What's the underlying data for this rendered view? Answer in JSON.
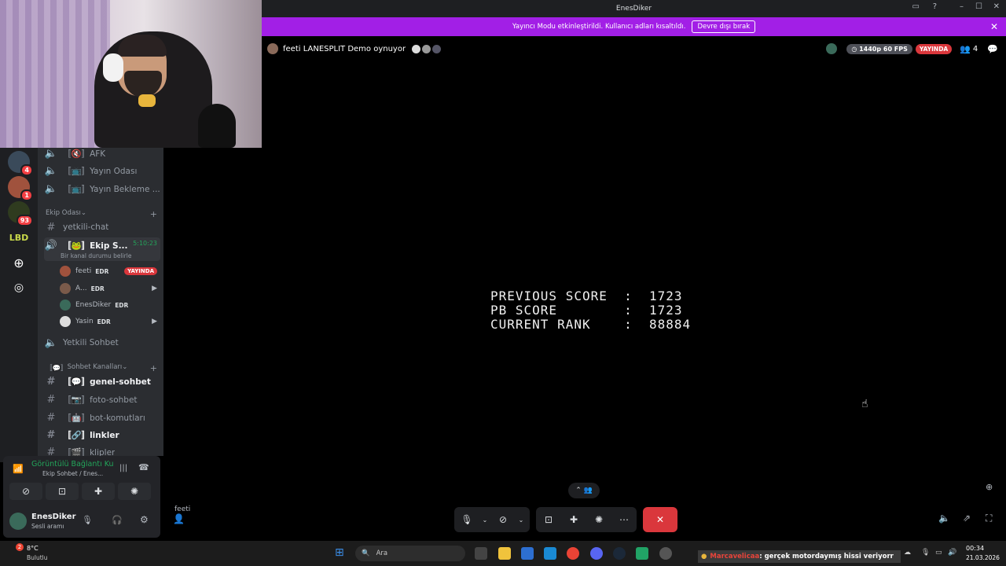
{
  "window": {
    "title": "EnesDiker",
    "minimize": "–",
    "maximize": "☐",
    "close": "✕"
  },
  "banner": {
    "message": "Yayıncı Modu etkinleştirildi. Kullanıcı adları kısaltıldı.",
    "button": "Devre dışı bırak",
    "close": "✕"
  },
  "stream": {
    "title": "feeti LANESPLIT Demo oynuyor",
    "quality": "1440p 60 FPS",
    "live": "YAYINDA",
    "viewers": "4",
    "participant": "feeti"
  },
  "game": {
    "lines": "PREVIOUS SCORE  :  1723\nPB SCORE        :  1723\nCURRENT RANK    :  88884"
  },
  "servers": [
    {
      "badge": "4"
    },
    {
      "badge": "1"
    },
    {
      "badge": "93"
    },
    {
      "label": "LBD"
    }
  ],
  "channels": {
    "afk": "AFK",
    "yayin_odasi": "Yayın Odası",
    "yayin_bekleme": "Yayın Bekleme ...",
    "cat_ekip": "Ekip Odası",
    "yetkili_chat": "yetkili-chat",
    "ekip_voice": "Ekip S...",
    "ekip_timer": "5:10:23",
    "ekip_status": "Bir kanal durumu belirle",
    "yetkili_sohbet": "Yetkili Sohbet",
    "cat_sohbet": "Sohbet Kanalları",
    "genel": "genel-sohbet",
    "foto": "foto-sohbet",
    "bot": "bot-komutları",
    "linkler": "linkler",
    "klipler": "klipler"
  },
  "voice_users": [
    {
      "name": "feeti",
      "tag": "EDR",
      "live": "YAYINDA"
    },
    {
      "name": "A...",
      "tag": "EDR"
    },
    {
      "name": "EnesDiker",
      "tag": "EDR"
    },
    {
      "name": "Yasin",
      "tag": "EDR"
    }
  ],
  "voice_panel": {
    "status": "Görüntülü Bağlantı Ku",
    "channel": "Ekip Sohbet / Enes..."
  },
  "user_panel": {
    "name": "EnesDiker",
    "status": "Sesli aramı"
  },
  "taskbar": {
    "weather_temp": "8°C",
    "weather_desc": "Bulutlu",
    "search": "Ara",
    "notification": "Marcavelicaa",
    "notification_text": ": gerçek motordaymış hissi veriyorr",
    "time": "00:34",
    "date": "21.03.2026"
  },
  "colors": {
    "accent": "#a21fe6",
    "danger": "#da373c",
    "sidebar": "#2b2d31"
  }
}
